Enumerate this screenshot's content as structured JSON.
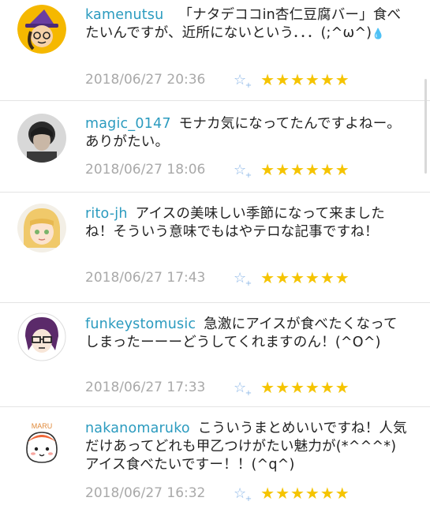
{
  "comments": [
    {
      "username": "kamenutsu",
      "text": "　「ナタデココin杏仁豆腐バー」食べたいんですが、近所にないという．．．(;^ω^)",
      "date": "2018/06/27 20:36",
      "stars": "★★★★★★",
      "star_count": 6
    },
    {
      "username": "magic_0147",
      "text": "モナカ気になってたんですよねー。ありがたい。",
      "date": "2018/06/27 18:06",
      "stars": "★★★★★★",
      "star_count": 6
    },
    {
      "username": "rito-jh",
      "text": "アイスの美味しい季節になって来ましたね！そういう意味でもはやテロな記事ですね！",
      "date": "2018/06/27 17:43",
      "stars": "★★★★★★",
      "star_count": 6
    },
    {
      "username": "funkeystomusic",
      "text": "急激にアイスが食べたくなってしまったーーーどうしてくれますのん！(^O^)",
      "date": "2018/06/27 17:33",
      "stars": "★★★★★★",
      "star_count": 6
    },
    {
      "username": "nakanomaruko",
      "text": "こういうまとめいいですね！人気だけあってどれも甲乙つけがたい魅力が(*^^^*)アイス食べたいですー！！(^q^)",
      "date": "2018/06/27 16:32",
      "stars": "★★★★★★",
      "star_count": 6
    }
  ],
  "avatar_text": {
    "maru": "MARU"
  },
  "add_star_icon": "star-outline-plus",
  "colors": {
    "username": "#2b9bbf",
    "star": "#f5c400",
    "add_star": "#8fb9e8",
    "date": "#a9a9a9"
  }
}
